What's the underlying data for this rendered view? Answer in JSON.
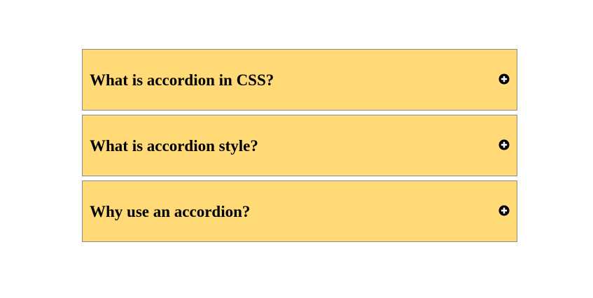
{
  "accordion": {
    "items": [
      {
        "label": "What is accordion in CSS?",
        "icon": "plus-circle-icon",
        "expanded": false
      },
      {
        "label": "What is accordion style?",
        "icon": "plus-circle-icon",
        "expanded": false
      },
      {
        "label": "Why use an accordion?",
        "icon": "plus-circle-icon",
        "expanded": false
      }
    ]
  },
  "colors": {
    "panel_background": "#ffda77",
    "panel_border": "#8c8c8c",
    "text": "#000000",
    "page_background": "#ffffff"
  }
}
